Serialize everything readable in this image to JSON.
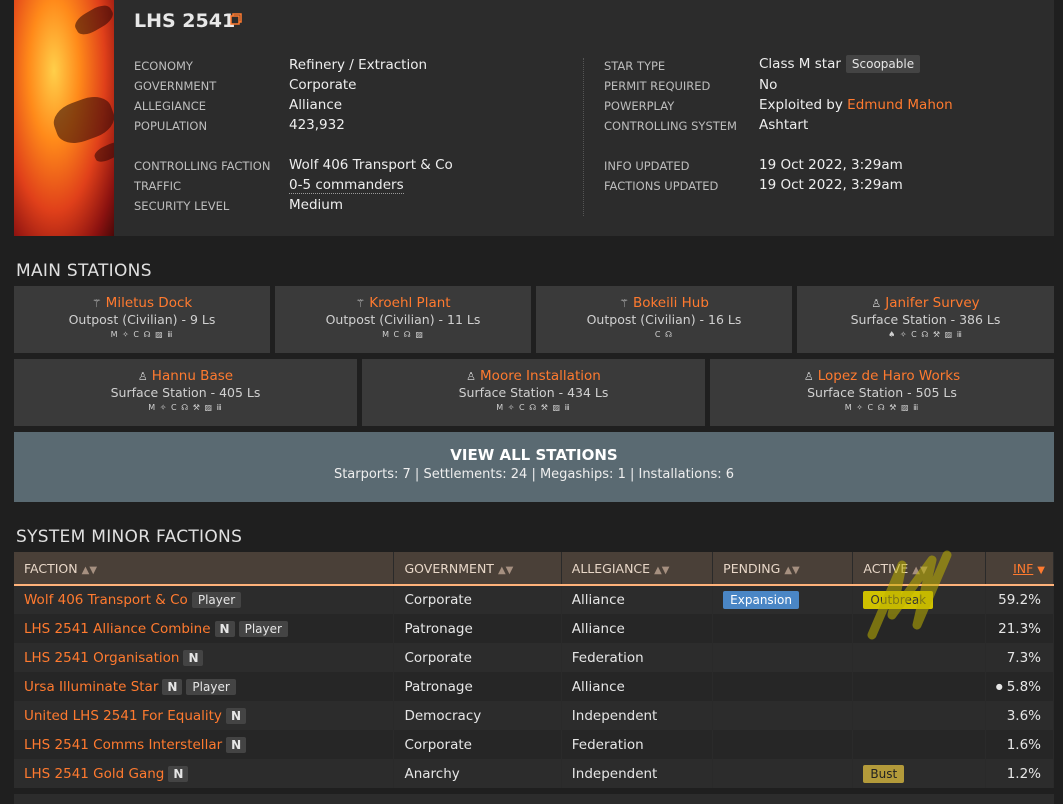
{
  "system": {
    "name": "LHS 2541",
    "left": [
      {
        "label": "ECONOMY",
        "value": "Refinery / Extraction"
      },
      {
        "label": "GOVERNMENT",
        "value": "Corporate"
      },
      {
        "label": "ALLEGIANCE",
        "value": "Alliance"
      },
      {
        "label": "POPULATION",
        "value": "423,932"
      },
      {
        "label": "CONTROLLING FACTION",
        "value": "Wolf 406 Transport & Co"
      },
      {
        "label": "TRAFFIC",
        "value": "0-5 commanders"
      },
      {
        "label": "SECURITY LEVEL",
        "value": "Medium"
      }
    ],
    "right": {
      "star_type_label": "STAR TYPE",
      "star_type_value": "Class M star",
      "star_badge": "Scoopable",
      "permit_label": "PERMIT REQUIRED",
      "permit_value": "No",
      "powerplay_label": "POWERPLAY",
      "powerplay_prefix": "Exploited by",
      "powerplay_link": "Edmund Mahon",
      "controlling_system_label": "CONTROLLING SYSTEM",
      "controlling_system_value": "Ashtart",
      "info_updated_label": "INFO UPDATED",
      "info_updated_value": "19 Oct 2022, 3:29am",
      "factions_updated_label": "FACTIONS UPDATED",
      "factions_updated_value": "19 Oct 2022, 3:29am"
    }
  },
  "main_stations": {
    "heading": "MAIN STATIONS",
    "items": [
      {
        "name": "Miletus Dock",
        "sub": "Outpost (Civilian) - 9 Ls",
        "services": "M ✧ C ☊ ▨ ⅲ",
        "icon": "outpost-icon"
      },
      {
        "name": "Kroehl Plant",
        "sub": "Outpost (Civilian) - 11 Ls",
        "services": "M C ☊ ▨",
        "icon": "outpost-icon"
      },
      {
        "name": "Bokeili Hub",
        "sub": "Outpost (Civilian) - 16 Ls",
        "services": "C ☊",
        "icon": "outpost-icon"
      },
      {
        "name": "Janifer Survey",
        "sub": "Surface Station - 386 Ls",
        "services": "♠ ✧ C ☊ ⚒ ▨ ⅲ",
        "icon": "surface-icon"
      },
      {
        "name": "Hannu Base",
        "sub": "Surface Station - 405 Ls",
        "services": "M ✧ C ☊ ⚒ ▨ ⅲ",
        "icon": "surface-icon"
      },
      {
        "name": "Moore Installation",
        "sub": "Surface Station - 434 Ls",
        "services": "M ✧ C ☊ ⚒ ▨ ⅲ",
        "icon": "surface-icon"
      },
      {
        "name": "Lopez de Haro Works",
        "sub": "Surface Station - 505 Ls",
        "services": "M ✧ C ☊ ⚒ ▨ ⅲ",
        "icon": "surface-icon"
      }
    ],
    "view_all": {
      "title": "VIEW ALL STATIONS",
      "summary": "Starports: 7 | Settlements: 24 | Megaships: 1 | Installations: 6"
    }
  },
  "factions": {
    "heading": "SYSTEM MINOR FACTIONS",
    "columns": [
      "FACTION",
      "GOVERNMENT",
      "ALLEGIANCE",
      "PENDING",
      "ACTIVE",
      "INF"
    ],
    "rows": [
      {
        "name": "Wolf 406 Transport & Co",
        "tags": [
          "Player"
        ],
        "government": "Corporate",
        "allegiance": "Alliance",
        "pending": "Expansion",
        "active": "Outbreak",
        "inf": "59.2%",
        "dot": false
      },
      {
        "name": "LHS 2541 Alliance Combine",
        "tags": [
          "N",
          "Player"
        ],
        "government": "Patronage",
        "allegiance": "Alliance",
        "pending": "",
        "active": "",
        "inf": "21.3%",
        "dot": false
      },
      {
        "name": "LHS 2541 Organisation",
        "tags": [
          "N"
        ],
        "government": "Corporate",
        "allegiance": "Federation",
        "pending": "",
        "active": "",
        "inf": "7.3%",
        "dot": false
      },
      {
        "name": "Ursa Illuminate Star",
        "tags": [
          "N",
          "Player"
        ],
        "government": "Patronage",
        "allegiance": "Alliance",
        "pending": "",
        "active": "",
        "inf": "5.8%",
        "dot": true
      },
      {
        "name": "United LHS 2541 For Equality",
        "tags": [
          "N"
        ],
        "government": "Democracy",
        "allegiance": "Independent",
        "pending": "",
        "active": "",
        "inf": "3.6%",
        "dot": false
      },
      {
        "name": "LHS 2541 Comms Interstellar",
        "tags": [
          "N"
        ],
        "government": "Corporate",
        "allegiance": "Federation",
        "pending": "",
        "active": "",
        "inf": "1.6%",
        "dot": false
      },
      {
        "name": "LHS 2541 Gold Gang",
        "tags": [
          "N"
        ],
        "government": "Anarchy",
        "allegiance": "Independent",
        "pending": "",
        "active": "Bust",
        "inf": "1.2%",
        "dot": false
      }
    ]
  },
  "colors": {
    "accent": "#ff7a2f",
    "pending_badge": "#4a86c5",
    "active_outbreak": "#cfc100",
    "active_bust": "#b39a3a"
  }
}
